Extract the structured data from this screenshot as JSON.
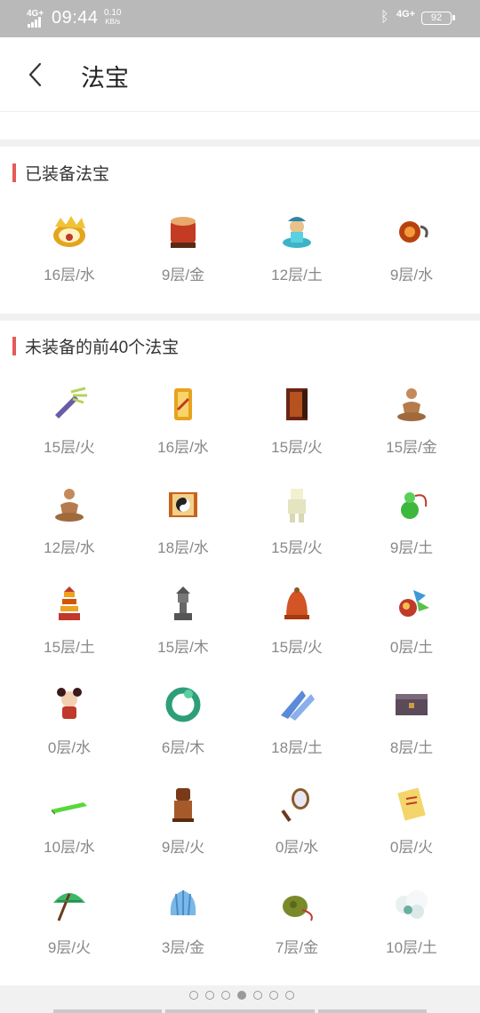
{
  "status": {
    "time": "09:44",
    "network_left": "4G+",
    "speed": "0.10",
    "speed_unit": "KB/s",
    "network_right": "4G+",
    "battery": "92"
  },
  "header": {
    "title": "法宝"
  },
  "equipped": {
    "title": "已装备法宝",
    "items": [
      {
        "label": "16层/水",
        "icon": "golden-crown-icon"
      },
      {
        "label": "9层/金",
        "icon": "red-drum-icon"
      },
      {
        "label": "12层/土",
        "icon": "genie-icon"
      },
      {
        "label": "9层/水",
        "icon": "gourd-icon"
      }
    ]
  },
  "unequipped": {
    "title": "未装备的前40个法宝",
    "items": [
      {
        "label": "15层/火",
        "icon": "arrow-fan-icon"
      },
      {
        "label": "16层/水",
        "icon": "golden-scroll-icon"
      },
      {
        "label": "15层/火",
        "icon": "banner-icon"
      },
      {
        "label": "15层/金",
        "icon": "meditating-monk-icon"
      },
      {
        "label": "12层/水",
        "icon": "meditating-monk-icon"
      },
      {
        "label": "18层/水",
        "icon": "taiji-scroll-icon"
      },
      {
        "label": "15层/火",
        "icon": "paper-doll-icon"
      },
      {
        "label": "9层/土",
        "icon": "green-gourd-icon"
      },
      {
        "label": "15层/土",
        "icon": "red-pagoda-icon"
      },
      {
        "label": "15层/木",
        "icon": "stone-lantern-icon"
      },
      {
        "label": "15层/火",
        "icon": "bell-icon"
      },
      {
        "label": "0层/土",
        "icon": "dragon-ornament-icon"
      },
      {
        "label": "0层/水",
        "icon": "doll-icon"
      },
      {
        "label": "6层/木",
        "icon": "jade-dragon-ring-icon"
      },
      {
        "label": "18层/土",
        "icon": "blue-wings-icon"
      },
      {
        "label": "8层/土",
        "icon": "chest-icon"
      },
      {
        "label": "10层/水",
        "icon": "jade-ruler-icon"
      },
      {
        "label": "9层/火",
        "icon": "seal-icon"
      },
      {
        "label": "0层/水",
        "icon": "mirror-icon"
      },
      {
        "label": "0层/火",
        "icon": "yellow-scroll-icon"
      },
      {
        "label": "9层/火",
        "icon": "green-umbrella-icon"
      },
      {
        "label": "3层/金",
        "icon": "blue-fan-icon"
      },
      {
        "label": "7层/金",
        "icon": "pouch-icon"
      },
      {
        "label": "10层/土",
        "icon": "white-cloud-icon"
      }
    ]
  },
  "pager": {
    "count": 7,
    "active": 3
  }
}
